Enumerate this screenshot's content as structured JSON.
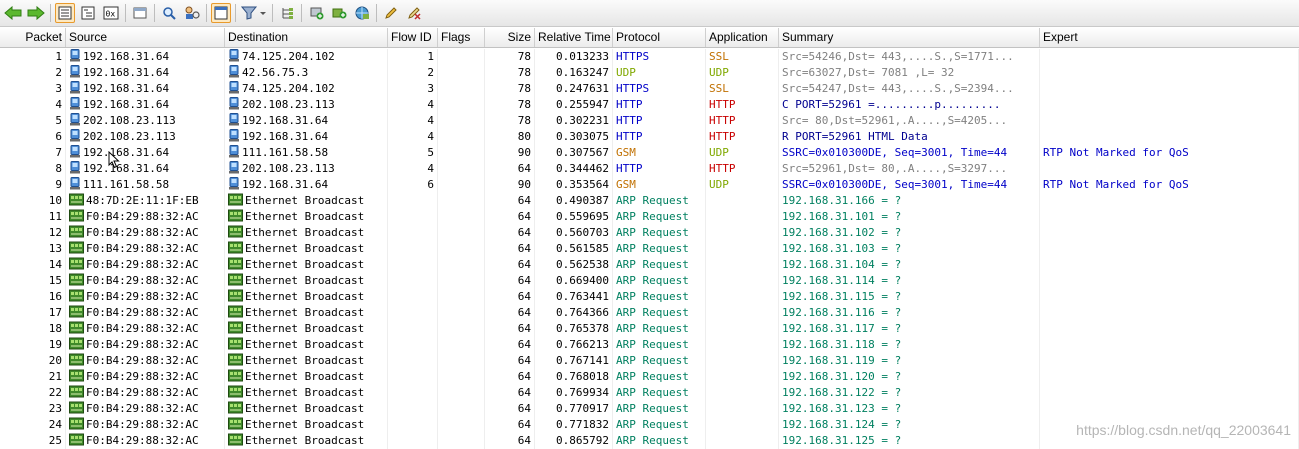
{
  "columns": {
    "packet": "Packet",
    "source": "Source",
    "destination": "Destination",
    "flow_id": "Flow ID",
    "flags": "Flags",
    "size": "Size",
    "relative_time": "Relative Time",
    "protocol": "Protocol",
    "application": "Application",
    "summary": "Summary",
    "expert": "Expert"
  },
  "colors": {
    "blue": "#0000c8",
    "orange": "#c07000",
    "green": "#80a800",
    "red": "#c80000",
    "gray": "#808080",
    "teal": "#008060",
    "navy": "#000090"
  },
  "rows": [
    {
      "packet": "1",
      "source": "192.168.31.64",
      "source_icon": "host-icon",
      "destination": "74.125.204.102",
      "destination_icon": "host-icon",
      "flow_id": "1",
      "flags": "",
      "size": "78",
      "time": "0.013233",
      "protocol": "HTTPS",
      "protocol_color": "#0000c8",
      "application": "SSL",
      "application_color": "#c07000",
      "summary": "Src=54246,Dst=  443,....S.,S=1771...",
      "summary_color": "#808080",
      "expert": ""
    },
    {
      "packet": "2",
      "source": "192.168.31.64",
      "source_icon": "host-icon",
      "destination": "42.56.75.3",
      "destination_icon": "host-icon",
      "flow_id": "2",
      "flags": "",
      "size": "78",
      "time": "0.163247",
      "protocol": "UDP",
      "protocol_color": "#80a800",
      "application": "UDP",
      "application_color": "#80a800",
      "summary": "Src=63027,Dst= 7081 ,L=   32",
      "summary_color": "#808080",
      "expert": ""
    },
    {
      "packet": "3",
      "source": "192.168.31.64",
      "source_icon": "host-icon",
      "destination": "74.125.204.102",
      "destination_icon": "host-icon",
      "flow_id": "3",
      "flags": "",
      "size": "78",
      "time": "0.247631",
      "protocol": "HTTPS",
      "protocol_color": "#0000c8",
      "application": "SSL",
      "application_color": "#c07000",
      "summary": "Src=54247,Dst=  443,....S.,S=2394...",
      "summary_color": "#808080",
      "expert": ""
    },
    {
      "packet": "4",
      "source": "192.168.31.64",
      "source_icon": "host-icon",
      "destination": "202.108.23.113",
      "destination_icon": "host-icon",
      "flow_id": "4",
      "flags": "",
      "size": "78",
      "time": "0.255947",
      "protocol": "HTTP",
      "protocol_color": "#0000c8",
      "application": "HTTP",
      "application_color": "#c80000",
      "summary": "C PORT=52961 =.........p.........",
      "summary_color": "#000090",
      "expert": ""
    },
    {
      "packet": "5",
      "source": "202.108.23.113",
      "source_icon": "host-icon",
      "destination": "192.168.31.64",
      "destination_icon": "host-icon",
      "flow_id": "4",
      "flags": "",
      "size": "78",
      "time": "0.302231",
      "protocol": "HTTP",
      "protocol_color": "#0000c8",
      "application": "HTTP",
      "application_color": "#c80000",
      "summary": "Src=   80,Dst=52961,.A....,S=4205...",
      "summary_color": "#808080",
      "expert": ""
    },
    {
      "packet": "6",
      "source": "202.108.23.113",
      "source_icon": "host-icon",
      "destination": "192.168.31.64",
      "destination_icon": "host-icon",
      "flow_id": "4",
      "flags": "",
      "size": "80",
      "time": "0.303075",
      "protocol": "HTTP",
      "protocol_color": "#0000c8",
      "application": "HTTP",
      "application_color": "#c80000",
      "summary": "R PORT=52961 HTML Data",
      "summary_color": "#000090",
      "expert": ""
    },
    {
      "packet": "7",
      "source": "192.168.31.64",
      "source_icon": "host-icon",
      "destination": "111.161.58.58",
      "destination_icon": "host-icon",
      "flow_id": "5",
      "flags": "",
      "size": "90",
      "time": "0.307567",
      "protocol": "GSM",
      "protocol_color": "#c07000",
      "application": "UDP",
      "application_color": "#80a800",
      "summary": "SSRC=0x010300DE, Seq=3001, Time=44",
      "summary_color": "#0000c8",
      "expert": "RTP Not Marked for QoS"
    },
    {
      "packet": "8",
      "source": "192.168.31.64",
      "source_icon": "host-icon",
      "destination": "202.108.23.113",
      "destination_icon": "host-icon",
      "flow_id": "4",
      "flags": "",
      "size": "64",
      "time": "0.344462",
      "protocol": "HTTP",
      "protocol_color": "#0000c8",
      "application": "HTTP",
      "application_color": "#c80000",
      "summary": "Src=52961,Dst=   80,.A....,S=3297...",
      "summary_color": "#808080",
      "expert": ""
    },
    {
      "packet": "9",
      "source": "111.161.58.58",
      "source_icon": "host-icon",
      "destination": "192.168.31.64",
      "destination_icon": "host-icon",
      "flow_id": "6",
      "flags": "",
      "size": "90",
      "time": "0.353564",
      "protocol": "GSM",
      "protocol_color": "#c07000",
      "application": "UDP",
      "application_color": "#80a800",
      "summary": "SSRC=0x010300DE, Seq=3001, Time=44",
      "summary_color": "#0000c8",
      "expert": "RTP Not Marked for QoS"
    },
    {
      "packet": "10",
      "source": "48:7D:2E:11:1F:EB",
      "source_icon": "nic-icon",
      "destination": "Ethernet Broadcast",
      "destination_icon": "nic-icon",
      "flow_id": "",
      "flags": "",
      "size": "64",
      "time": "0.490387",
      "protocol": "ARP Request",
      "protocol_color": "#008060",
      "application": "",
      "application_color": "#000000",
      "summary": "192.168.31.166 = ?",
      "summary_color": "#008060",
      "expert": ""
    },
    {
      "packet": "11",
      "source": "F0:B4:29:88:32:AC",
      "source_icon": "nic-icon",
      "destination": "Ethernet Broadcast",
      "destination_icon": "nic-icon",
      "flow_id": "",
      "flags": "",
      "size": "64",
      "time": "0.559695",
      "protocol": "ARP Request",
      "protocol_color": "#008060",
      "application": "",
      "application_color": "#000000",
      "summary": "192.168.31.101 = ?",
      "summary_color": "#008060",
      "expert": ""
    },
    {
      "packet": "12",
      "source": "F0:B4:29:88:32:AC",
      "source_icon": "nic-icon",
      "destination": "Ethernet Broadcast",
      "destination_icon": "nic-icon",
      "flow_id": "",
      "flags": "",
      "size": "64",
      "time": "0.560703",
      "protocol": "ARP Request",
      "protocol_color": "#008060",
      "application": "",
      "application_color": "#000000",
      "summary": "192.168.31.102 = ?",
      "summary_color": "#008060",
      "expert": ""
    },
    {
      "packet": "13",
      "source": "F0:B4:29:88:32:AC",
      "source_icon": "nic-icon",
      "destination": "Ethernet Broadcast",
      "destination_icon": "nic-icon",
      "flow_id": "",
      "flags": "",
      "size": "64",
      "time": "0.561585",
      "protocol": "ARP Request",
      "protocol_color": "#008060",
      "application": "",
      "application_color": "#000000",
      "summary": "192.168.31.103 = ?",
      "summary_color": "#008060",
      "expert": ""
    },
    {
      "packet": "14",
      "source": "F0:B4:29:88:32:AC",
      "source_icon": "nic-icon",
      "destination": "Ethernet Broadcast",
      "destination_icon": "nic-icon",
      "flow_id": "",
      "flags": "",
      "size": "64",
      "time": "0.562538",
      "protocol": "ARP Request",
      "protocol_color": "#008060",
      "application": "",
      "application_color": "#000000",
      "summary": "192.168.31.104 = ?",
      "summary_color": "#008060",
      "expert": ""
    },
    {
      "packet": "15",
      "source": "F0:B4:29:88:32:AC",
      "source_icon": "nic-icon",
      "destination": "Ethernet Broadcast",
      "destination_icon": "nic-icon",
      "flow_id": "",
      "flags": "",
      "size": "64",
      "time": "0.669400",
      "protocol": "ARP Request",
      "protocol_color": "#008060",
      "application": "",
      "application_color": "#000000",
      "summary": "192.168.31.114 = ?",
      "summary_color": "#008060",
      "expert": ""
    },
    {
      "packet": "16",
      "source": "F0:B4:29:88:32:AC",
      "source_icon": "nic-icon",
      "destination": "Ethernet Broadcast",
      "destination_icon": "nic-icon",
      "flow_id": "",
      "flags": "",
      "size": "64",
      "time": "0.763441",
      "protocol": "ARP Request",
      "protocol_color": "#008060",
      "application": "",
      "application_color": "#000000",
      "summary": "192.168.31.115 = ?",
      "summary_color": "#008060",
      "expert": ""
    },
    {
      "packet": "17",
      "source": "F0:B4:29:88:32:AC",
      "source_icon": "nic-icon",
      "destination": "Ethernet Broadcast",
      "destination_icon": "nic-icon",
      "flow_id": "",
      "flags": "",
      "size": "64",
      "time": "0.764366",
      "protocol": "ARP Request",
      "protocol_color": "#008060",
      "application": "",
      "application_color": "#000000",
      "summary": "192.168.31.116 = ?",
      "summary_color": "#008060",
      "expert": ""
    },
    {
      "packet": "18",
      "source": "F0:B4:29:88:32:AC",
      "source_icon": "nic-icon",
      "destination": "Ethernet Broadcast",
      "destination_icon": "nic-icon",
      "flow_id": "",
      "flags": "",
      "size": "64",
      "time": "0.765378",
      "protocol": "ARP Request",
      "protocol_color": "#008060",
      "application": "",
      "application_color": "#000000",
      "summary": "192.168.31.117 = ?",
      "summary_color": "#008060",
      "expert": ""
    },
    {
      "packet": "19",
      "source": "F0:B4:29:88:32:AC",
      "source_icon": "nic-icon",
      "destination": "Ethernet Broadcast",
      "destination_icon": "nic-icon",
      "flow_id": "",
      "flags": "",
      "size": "64",
      "time": "0.766213",
      "protocol": "ARP Request",
      "protocol_color": "#008060",
      "application": "",
      "application_color": "#000000",
      "summary": "192.168.31.118 = ?",
      "summary_color": "#008060",
      "expert": ""
    },
    {
      "packet": "20",
      "source": "F0:B4:29:88:32:AC",
      "source_icon": "nic-icon",
      "destination": "Ethernet Broadcast",
      "destination_icon": "nic-icon",
      "flow_id": "",
      "flags": "",
      "size": "64",
      "time": "0.767141",
      "protocol": "ARP Request",
      "protocol_color": "#008060",
      "application": "",
      "application_color": "#000000",
      "summary": "192.168.31.119 = ?",
      "summary_color": "#008060",
      "expert": ""
    },
    {
      "packet": "21",
      "source": "F0:B4:29:88:32:AC",
      "source_icon": "nic-icon",
      "destination": "Ethernet Broadcast",
      "destination_icon": "nic-icon",
      "flow_id": "",
      "flags": "",
      "size": "64",
      "time": "0.768018",
      "protocol": "ARP Request",
      "protocol_color": "#008060",
      "application": "",
      "application_color": "#000000",
      "summary": "192.168.31.120 = ?",
      "summary_color": "#008060",
      "expert": ""
    },
    {
      "packet": "22",
      "source": "F0:B4:29:88:32:AC",
      "source_icon": "nic-icon",
      "destination": "Ethernet Broadcast",
      "destination_icon": "nic-icon",
      "flow_id": "",
      "flags": "",
      "size": "64",
      "time": "0.769934",
      "protocol": "ARP Request",
      "protocol_color": "#008060",
      "application": "",
      "application_color": "#000000",
      "summary": "192.168.31.122 = ?",
      "summary_color": "#008060",
      "expert": ""
    },
    {
      "packet": "23",
      "source": "F0:B4:29:88:32:AC",
      "source_icon": "nic-icon",
      "destination": "Ethernet Broadcast",
      "destination_icon": "nic-icon",
      "flow_id": "",
      "flags": "",
      "size": "64",
      "time": "0.770917",
      "protocol": "ARP Request",
      "protocol_color": "#008060",
      "application": "",
      "application_color": "#000000",
      "summary": "192.168.31.123 = ?",
      "summary_color": "#008060",
      "expert": ""
    },
    {
      "packet": "24",
      "source": "F0:B4:29:88:32:AC",
      "source_icon": "nic-icon",
      "destination": "Ethernet Broadcast",
      "destination_icon": "nic-icon",
      "flow_id": "",
      "flags": "",
      "size": "64",
      "time": "0.771832",
      "protocol": "ARP Request",
      "protocol_color": "#008060",
      "application": "",
      "application_color": "#000000",
      "summary": "192.168.31.124 = ?",
      "summary_color": "#008060",
      "expert": ""
    },
    {
      "packet": "25",
      "source": "F0:B4:29:88:32:AC",
      "source_icon": "nic-icon",
      "destination": "Ethernet Broadcast",
      "destination_icon": "nic-icon",
      "flow_id": "",
      "flags": "",
      "size": "64",
      "time": "0.865792",
      "protocol": "ARP Request",
      "protocol_color": "#008060",
      "application": "",
      "application_color": "#000000",
      "summary": "192.168.31.125 = ?",
      "summary_color": "#008060",
      "expert": ""
    }
  ],
  "watermark": "https://blog.csdn.net/qq_22003641"
}
